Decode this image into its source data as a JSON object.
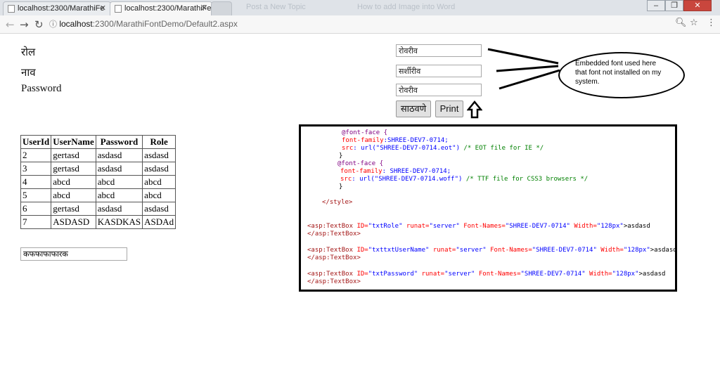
{
  "browser": {
    "tabs": [
      {
        "label": "localhost:2300/MarathiFе",
        "active": false
      },
      {
        "label": "localhost:2300/MarathiFе",
        "active": true
      }
    ],
    "ghost_tabs": [
      "Post a New Topic",
      "How to add Image into Word"
    ],
    "address_host": "localhost",
    "address_path": ":2300/MarathiFontDemo/Default2.aspx"
  },
  "form": {
    "role_label": "रोल",
    "name_label": "नाव",
    "password_label": "Password",
    "role_value": "रोवरीव",
    "username_value": "सर्शीरीव",
    "password_value": "रोवरीव",
    "save_button": "साठवणे",
    "print_button": "Print",
    "extra_textbox_value": "कफफाफाफारक"
  },
  "table": {
    "headers": [
      "UserId",
      "UserName",
      "Password",
      "Role"
    ],
    "rows": [
      [
        "2",
        "gertasd",
        "asdasd",
        "asdasd"
      ],
      [
        "3",
        "gertasd",
        "asdasd",
        "asdasd"
      ],
      [
        "4",
        "abcd",
        "abcd",
        "abcd"
      ],
      [
        "5",
        "abcd",
        "abcd",
        "abcd"
      ],
      [
        "6",
        "gertasd",
        "asdasd",
        "asdasd"
      ],
      [
        "7",
        "ASDASD",
        "KASDKAS",
        "ASDAd"
      ]
    ]
  },
  "annotation": {
    "callout": "Embedded font used here that font not installed on my system."
  },
  "code": {
    "l1": "@font-face {",
    "l2a": "font-family",
    "l2b": ":SHREE-DEV7-0714;",
    "l3a": "src",
    "l3b": ": url(\"SHREE-DEV7-0714.eot\")",
    "l3c": " /* EOT file for IE */",
    "l4": "}",
    "l5": "@font-face {",
    "l6a": "font-family",
    "l6b": ": SHREE-DEV7-0714;",
    "l7a": "src",
    "l7b": ": url(\"SHREE-DEV7-0714.woff\")",
    "l7c": " /* TTF file for CSS3 browsers */",
    "l8": "}",
    "l9": "</style>",
    "tb1a": "<asp:TextBox",
    "tb1b": " ID=",
    "tb1c": "\"txtRole\"",
    "tb1d": " runat=",
    "tb1e": "\"server\"",
    "tb1f": " Font-Names=",
    "tb1g": "\"SHREE-DEV7-0714\"",
    "tb1h": " Width=",
    "tb1i": "\"128px\"",
    "tb1j": ">asdasd",
    "tb1k": "</asp:TextBox>",
    "tb2a": "<asp:TextBox",
    "tb2b": " ID=",
    "tb2c": "\"txttxtUserName\"",
    "tb2d": " runat=",
    "tb2e": "\"server\"",
    "tb2f": " Font-Names=",
    "tb2g": "\"SHREE-DEV7-0714\"",
    "tb2h": " Width=",
    "tb2i": "\"128px\"",
    "tb2j": ">asdasd",
    "tb2k": "</asp:TextBox>",
    "tb3a": "<asp:TextBox",
    "tb3b": " ID=",
    "tb3c": "\"txtPassword\"",
    "tb3d": " runat=",
    "tb3e": "\"server\"",
    "tb3f": " Font-Names=",
    "tb3g": "\"SHREE-DEV7-0714\"",
    "tb3h": " Width=",
    "tb3i": "\"128px\"",
    "tb3j": ">asdasd",
    "tb3k": "</asp:TextBox>"
  }
}
